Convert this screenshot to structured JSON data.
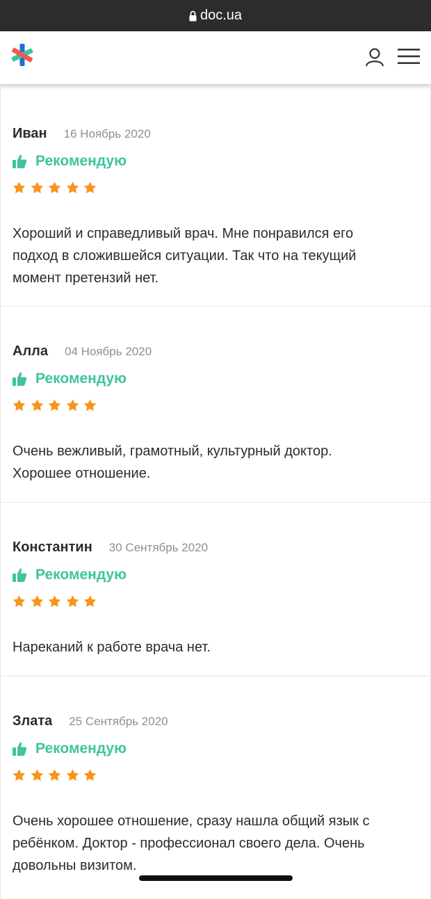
{
  "browser": {
    "url": "doc.ua",
    "lock_icon": "lock-icon"
  },
  "header": {
    "logo_icon": "doc-ua-asterisk-logo",
    "profile_icon": "user-icon",
    "menu_icon": "hamburger-menu-icon"
  },
  "colors": {
    "recommend": "#3fc3a0",
    "star": "#f7941d",
    "date": "#8f8f8f",
    "topbar": "#2c2c2e"
  },
  "reviews": [
    {
      "name": "Иван",
      "date": "16 Ноябрь 2020",
      "recommend": "Рекомендую",
      "rating": 5,
      "text_lines": [
        "Хороший и справедливый врач. Мне понравился его",
        "подход в сложившейся ситуации. Так что на текущий",
        "момент претензий нет."
      ]
    },
    {
      "name": "Алла",
      "date": "04 Ноябрь 2020",
      "recommend": "Рекомендую",
      "rating": 5,
      "text_lines": [
        "Очень вежливый, грамотный, культурный доктор.",
        "Хорошее отношение."
      ]
    },
    {
      "name": "Константин",
      "date": "30 Сентябрь 2020",
      "recommend": "Рекомендую",
      "rating": 5,
      "text_lines": [
        "Нареканий к работе врача нет."
      ]
    },
    {
      "name": "Злата",
      "date": "25 Сентябрь 2020",
      "recommend": "Рекомендую",
      "rating": 5,
      "text_lines": [
        "Очень хорошее отношение, сразу нашла общий язык с",
        "ребёнком. Доктор - профессионал своего дела. Очень",
        "довольны визитом."
      ]
    }
  ]
}
